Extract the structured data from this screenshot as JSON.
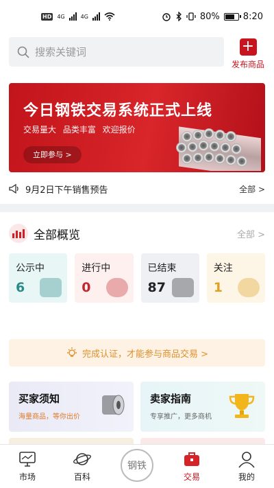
{
  "status_bar": {
    "network_badge": "HD",
    "signal_1": "4G",
    "signal_2": "4G",
    "battery": "80%",
    "battery_level": 0.8,
    "time": "8:20"
  },
  "search": {
    "placeholder": "搜索关键词"
  },
  "publish": {
    "label": "发布商品",
    "icon": "plus-icon",
    "color": "#c8141e"
  },
  "banner": {
    "title": "今日钢铁交易系统正式上线",
    "subtitle": "交易量大 品类丰富 欢迎报价",
    "button": "立即参与 >"
  },
  "notice": {
    "text": "9月2日下午销售预告",
    "more": "全部 >"
  },
  "overview": {
    "title": "全部概览",
    "more": "全部 >",
    "cards": [
      {
        "label": "公示中",
        "value": "6",
        "color": "#2a8a8a",
        "bg": "#e8f6f5"
      },
      {
        "label": "进行中",
        "value": "0",
        "color": "#c0282d",
        "bg": "#fdf0ef"
      },
      {
        "label": "已结束",
        "value": "87",
        "color": "#222222",
        "bg": "#eef0f4"
      },
      {
        "label": "关注",
        "value": "1",
        "color": "#e0a020",
        "bg": "#fdf5e6"
      }
    ]
  },
  "auth": {
    "text": "完成认证，才能参与商品交易 >"
  },
  "guides": {
    "buyer": {
      "title": "买家须知",
      "subtitle": "海量商品，等你出价"
    },
    "seller": {
      "title": "卖家指南",
      "subtitle": "专享推广，更多商机"
    }
  },
  "tabbar": {
    "items": [
      {
        "label": "市场",
        "icon": "monitor-icon"
      },
      {
        "label": "百科",
        "icon": "planet-icon"
      },
      {
        "label": "钢铁",
        "icon": "center-logo"
      },
      {
        "label": "交易",
        "icon": "briefcase-icon",
        "active": true
      },
      {
        "label": "我的",
        "icon": "user-icon"
      }
    ]
  }
}
